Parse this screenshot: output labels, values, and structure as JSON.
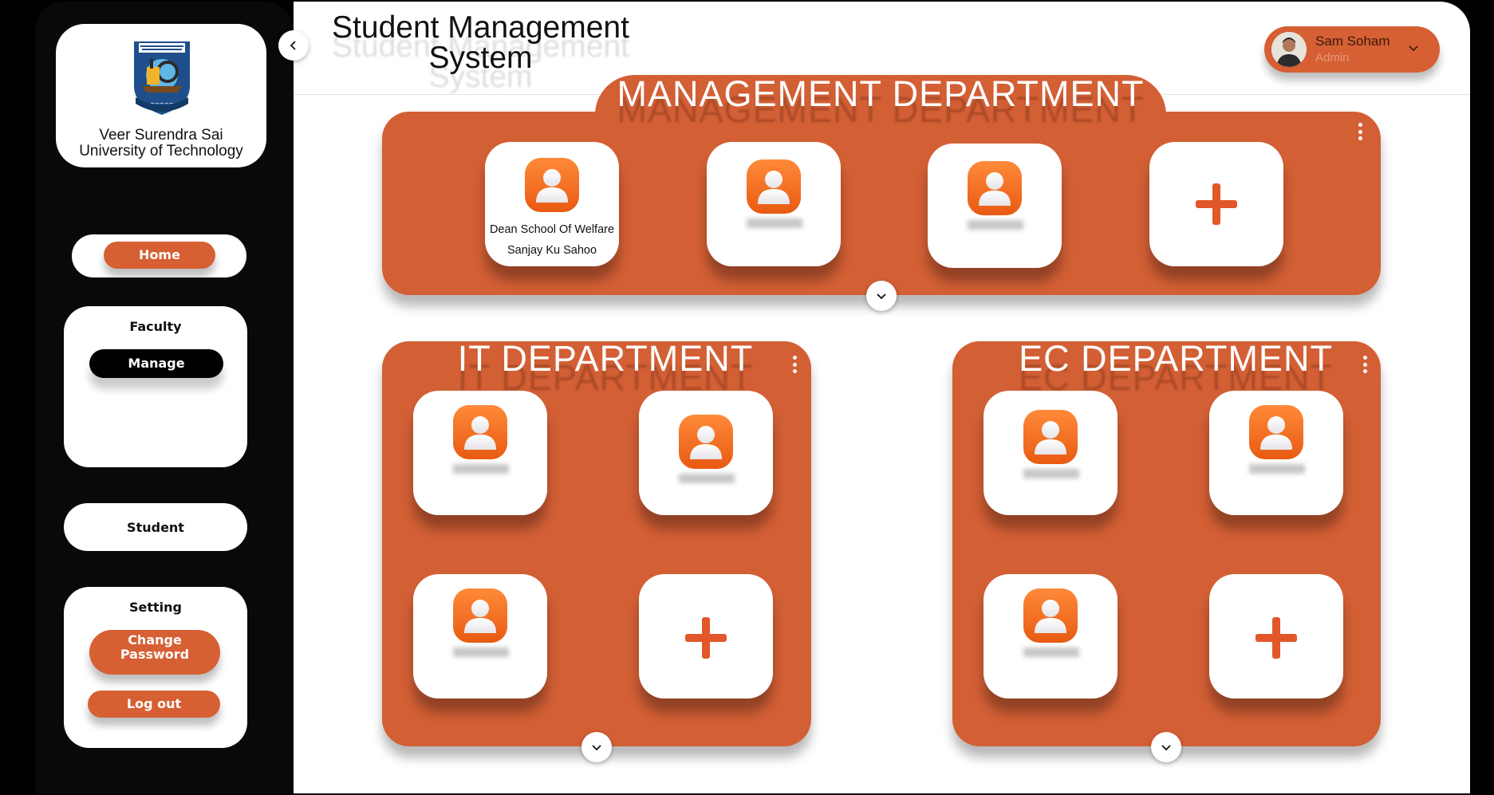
{
  "app": {
    "title_line1": "Student Management",
    "title_line2": "System"
  },
  "sidebar": {
    "university_line1": "Veer Surendra Sai",
    "university_line2": "University of Technology",
    "home_label": "Home",
    "faculty": {
      "title": "Faculty",
      "manage_label": "Manage"
    },
    "student_label": "Student",
    "setting": {
      "title": "Setting",
      "change_password_line1": "Change",
      "change_password_line2": "Password",
      "logout_label": "Log out"
    }
  },
  "user": {
    "name": "Sam Soham",
    "role": "Admin"
  },
  "departments": {
    "management": {
      "title": "MANAGEMENT DEPARTMENT",
      "members": [
        {
          "line1": "Dean School Of Welfare",
          "line2": "Sanjay Ku Sahoo"
        }
      ]
    },
    "it": {
      "title": "IT DEPARTMENT"
    },
    "ec": {
      "title": "EC DEPARTMENT"
    }
  },
  "colors": {
    "accent": "#d35f35",
    "sidebar_bg": "#090909",
    "card_bg": "#ffffff"
  },
  "icons": [
    "collapse-chevron-left-icon",
    "user-avatar-icon",
    "add-plus-icon",
    "more-vertical-icon",
    "expand-chevron-down-icon",
    "dropdown-chevron-icon"
  ]
}
